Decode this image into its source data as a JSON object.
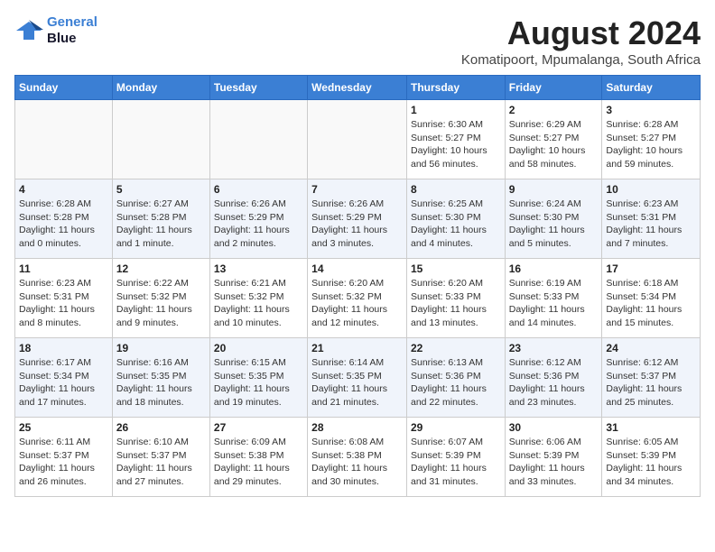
{
  "logo": {
    "line1": "General",
    "line2": "Blue"
  },
  "title": "August 2024",
  "subtitle": "Komatipoort, Mpumalanga, South Africa",
  "days_of_week": [
    "Sunday",
    "Monday",
    "Tuesday",
    "Wednesday",
    "Thursday",
    "Friday",
    "Saturday"
  ],
  "weeks": [
    [
      {
        "day": "",
        "info": ""
      },
      {
        "day": "",
        "info": ""
      },
      {
        "day": "",
        "info": ""
      },
      {
        "day": "",
        "info": ""
      },
      {
        "day": "1",
        "info": "Sunrise: 6:30 AM\nSunset: 5:27 PM\nDaylight: 10 hours\nand 56 minutes."
      },
      {
        "day": "2",
        "info": "Sunrise: 6:29 AM\nSunset: 5:27 PM\nDaylight: 10 hours\nand 58 minutes."
      },
      {
        "day": "3",
        "info": "Sunrise: 6:28 AM\nSunset: 5:27 PM\nDaylight: 10 hours\nand 59 minutes."
      }
    ],
    [
      {
        "day": "4",
        "info": "Sunrise: 6:28 AM\nSunset: 5:28 PM\nDaylight: 11 hours\nand 0 minutes."
      },
      {
        "day": "5",
        "info": "Sunrise: 6:27 AM\nSunset: 5:28 PM\nDaylight: 11 hours\nand 1 minute."
      },
      {
        "day": "6",
        "info": "Sunrise: 6:26 AM\nSunset: 5:29 PM\nDaylight: 11 hours\nand 2 minutes."
      },
      {
        "day": "7",
        "info": "Sunrise: 6:26 AM\nSunset: 5:29 PM\nDaylight: 11 hours\nand 3 minutes."
      },
      {
        "day": "8",
        "info": "Sunrise: 6:25 AM\nSunset: 5:30 PM\nDaylight: 11 hours\nand 4 minutes."
      },
      {
        "day": "9",
        "info": "Sunrise: 6:24 AM\nSunset: 5:30 PM\nDaylight: 11 hours\nand 5 minutes."
      },
      {
        "day": "10",
        "info": "Sunrise: 6:23 AM\nSunset: 5:31 PM\nDaylight: 11 hours\nand 7 minutes."
      }
    ],
    [
      {
        "day": "11",
        "info": "Sunrise: 6:23 AM\nSunset: 5:31 PM\nDaylight: 11 hours\nand 8 minutes."
      },
      {
        "day": "12",
        "info": "Sunrise: 6:22 AM\nSunset: 5:32 PM\nDaylight: 11 hours\nand 9 minutes."
      },
      {
        "day": "13",
        "info": "Sunrise: 6:21 AM\nSunset: 5:32 PM\nDaylight: 11 hours\nand 10 minutes."
      },
      {
        "day": "14",
        "info": "Sunrise: 6:20 AM\nSunset: 5:32 PM\nDaylight: 11 hours\nand 12 minutes."
      },
      {
        "day": "15",
        "info": "Sunrise: 6:20 AM\nSunset: 5:33 PM\nDaylight: 11 hours\nand 13 minutes."
      },
      {
        "day": "16",
        "info": "Sunrise: 6:19 AM\nSunset: 5:33 PM\nDaylight: 11 hours\nand 14 minutes."
      },
      {
        "day": "17",
        "info": "Sunrise: 6:18 AM\nSunset: 5:34 PM\nDaylight: 11 hours\nand 15 minutes."
      }
    ],
    [
      {
        "day": "18",
        "info": "Sunrise: 6:17 AM\nSunset: 5:34 PM\nDaylight: 11 hours\nand 17 minutes."
      },
      {
        "day": "19",
        "info": "Sunrise: 6:16 AM\nSunset: 5:35 PM\nDaylight: 11 hours\nand 18 minutes."
      },
      {
        "day": "20",
        "info": "Sunrise: 6:15 AM\nSunset: 5:35 PM\nDaylight: 11 hours\nand 19 minutes."
      },
      {
        "day": "21",
        "info": "Sunrise: 6:14 AM\nSunset: 5:35 PM\nDaylight: 11 hours\nand 21 minutes."
      },
      {
        "day": "22",
        "info": "Sunrise: 6:13 AM\nSunset: 5:36 PM\nDaylight: 11 hours\nand 22 minutes."
      },
      {
        "day": "23",
        "info": "Sunrise: 6:12 AM\nSunset: 5:36 PM\nDaylight: 11 hours\nand 23 minutes."
      },
      {
        "day": "24",
        "info": "Sunrise: 6:12 AM\nSunset: 5:37 PM\nDaylight: 11 hours\nand 25 minutes."
      }
    ],
    [
      {
        "day": "25",
        "info": "Sunrise: 6:11 AM\nSunset: 5:37 PM\nDaylight: 11 hours\nand 26 minutes."
      },
      {
        "day": "26",
        "info": "Sunrise: 6:10 AM\nSunset: 5:37 PM\nDaylight: 11 hours\nand 27 minutes."
      },
      {
        "day": "27",
        "info": "Sunrise: 6:09 AM\nSunset: 5:38 PM\nDaylight: 11 hours\nand 29 minutes."
      },
      {
        "day": "28",
        "info": "Sunrise: 6:08 AM\nSunset: 5:38 PM\nDaylight: 11 hours\nand 30 minutes."
      },
      {
        "day": "29",
        "info": "Sunrise: 6:07 AM\nSunset: 5:39 PM\nDaylight: 11 hours\nand 31 minutes."
      },
      {
        "day": "30",
        "info": "Sunrise: 6:06 AM\nSunset: 5:39 PM\nDaylight: 11 hours\nand 33 minutes."
      },
      {
        "day": "31",
        "info": "Sunrise: 6:05 AM\nSunset: 5:39 PM\nDaylight: 11 hours\nand 34 minutes."
      }
    ]
  ]
}
